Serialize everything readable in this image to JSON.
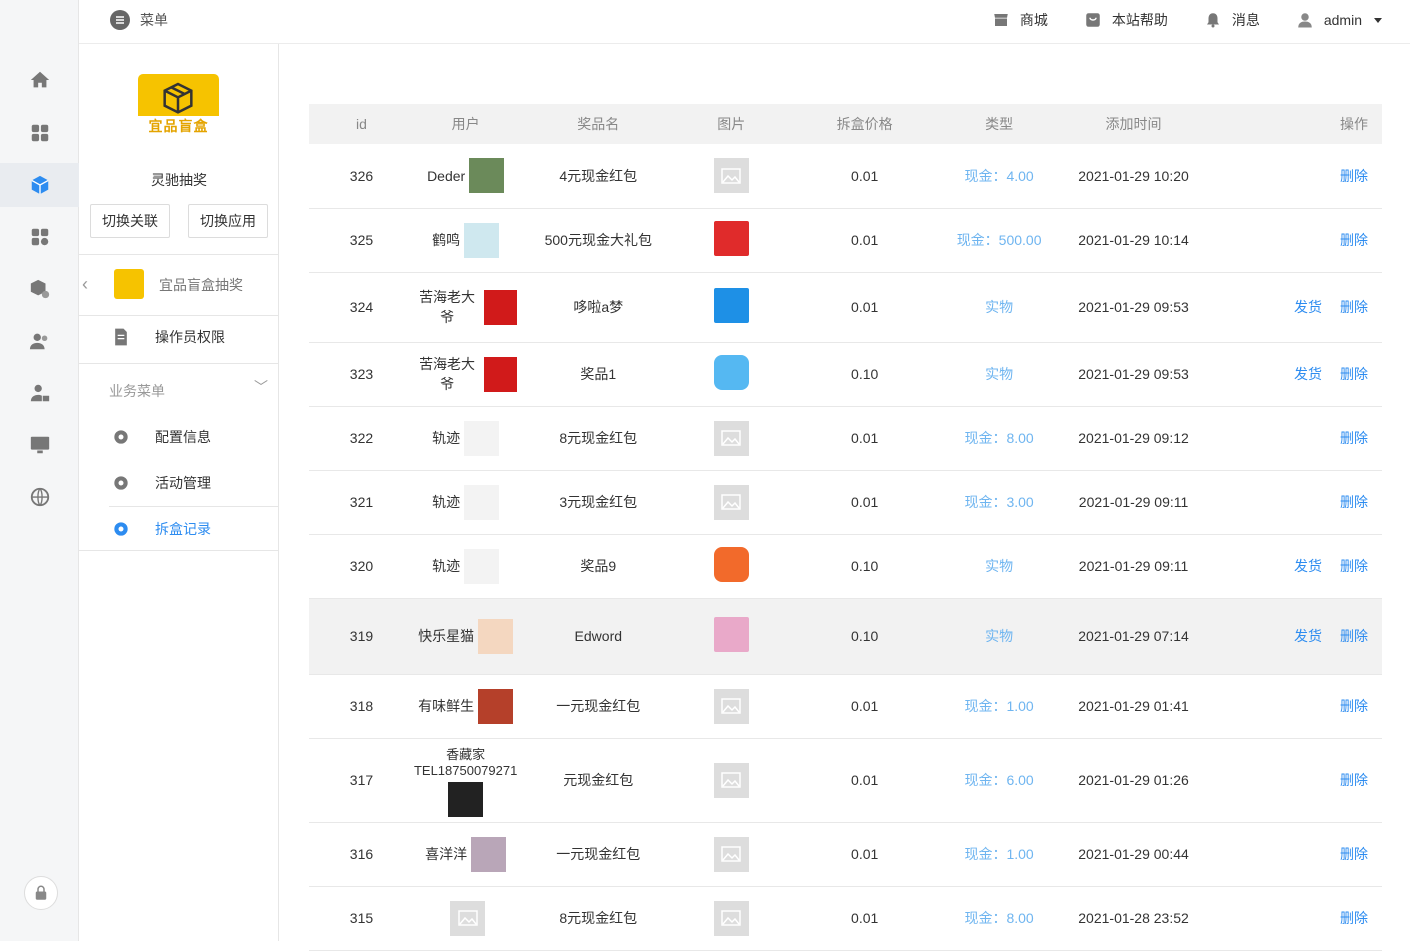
{
  "topbar": {
    "menu_label": "菜单",
    "links": [
      {
        "label": "商城",
        "icon": "store-icon"
      },
      {
        "label": "本站帮助",
        "icon": "help-icon"
      },
      {
        "label": "消息",
        "icon": "bell-icon"
      },
      {
        "label": "admin",
        "icon": "user-icon"
      }
    ]
  },
  "rail": {
    "items": [
      "home-icon",
      "grid-icon",
      "box-icon",
      "apps-icon",
      "box-gear-icon",
      "users-icon",
      "user-lock-icon",
      "monitor-icon",
      "globe-icon"
    ],
    "active_index": 2,
    "bottom": "lock-icon"
  },
  "subnav": {
    "brand_tag": "宜品盲盒",
    "app_name": "灵驰抽奖",
    "switch_link": "切换关联",
    "switch_app": "切换应用",
    "back_title": "宜品盲盒抽奖",
    "operator_permissions": "操作员权限",
    "group_title": "业务菜单",
    "items": [
      {
        "label": "配置信息",
        "icon": "gear-icon"
      },
      {
        "label": "活动管理",
        "icon": "gear-icon"
      },
      {
        "label": "拆盒记录",
        "icon": "gear-icon",
        "active": true
      }
    ]
  },
  "table": {
    "headers": [
      "id",
      "用户",
      "奖品名",
      "图片",
      "拆盒价格",
      "类型",
      "添加时间",
      "操作"
    ],
    "action_ship": "发货",
    "action_delete": "删除",
    "rows": [
      {
        "id": "326",
        "user": "Deder",
        "avatar": "photo-avatar",
        "prize": "4元现金红包",
        "image": "placeholder-image",
        "price": "0.01",
        "type": "现金：4.00",
        "time": "2021-01-29 10:20",
        "ship": false
      },
      {
        "id": "325",
        "user": "鹤鸣",
        "avatar": "cartoon-avatar",
        "prize": "500元现金大礼包",
        "image": "red-envelope-image",
        "price": "0.01",
        "type": "现金：500.00",
        "time": "2021-01-29 10:14",
        "ship": false
      },
      {
        "id": "324",
        "user": "苦海老大爷",
        "avatar": "fu-avatar",
        "prize": "哆啦a梦",
        "image": "doraemon-image",
        "price": "0.01",
        "type": "实物",
        "time": "2021-01-29 09:53",
        "ship": true
      },
      {
        "id": "323",
        "user": "苦海老大爷",
        "avatar": "fu-avatar",
        "prize": "奖品1",
        "image": "blue-app-image",
        "price": "0.10",
        "type": "实物",
        "time": "2021-01-29 09:53",
        "ship": true
      },
      {
        "id": "322",
        "user": "轨迹",
        "avatar": "text-avatar",
        "prize": "8元现金红包",
        "image": "placeholder-image",
        "price": "0.01",
        "type": "现金：8.00",
        "time": "2021-01-29 09:12",
        "ship": false
      },
      {
        "id": "321",
        "user": "轨迹",
        "avatar": "text-avatar",
        "prize": "3元现金红包",
        "image": "placeholder-image",
        "price": "0.01",
        "type": "现金：3.00",
        "time": "2021-01-29 09:11",
        "ship": false
      },
      {
        "id": "320",
        "user": "轨迹",
        "avatar": "text-avatar",
        "prize": "奖品9",
        "image": "orange-app-image",
        "price": "0.10",
        "type": "实物",
        "time": "2021-01-29 09:11",
        "ship": true
      },
      {
        "id": "319",
        "user": "快乐星猫",
        "avatar": "girl-avatar",
        "prize": "Edword",
        "image": "pink-scene-image",
        "price": "0.10",
        "type": "实物",
        "time": "2021-01-29 07:14",
        "ship": true,
        "highlight": true
      },
      {
        "id": "318",
        "user": "有味鲜生",
        "avatar": "food-avatar",
        "prize": "一元现金红包",
        "image": "placeholder-image",
        "price": "0.01",
        "type": "现金：1.00",
        "time": "2021-01-29 01:41",
        "ship": false
      },
      {
        "id": "317",
        "user": "香藏家TEL18750079271",
        "avatar": "dark-avatar",
        "prize": "元现金红包",
        "image": "placeholder-image",
        "price": "0.01",
        "type": "现金：6.00",
        "time": "2021-01-29 01:26",
        "ship": false
      },
      {
        "id": "316",
        "user": "喜洋洋",
        "avatar": "face-avatar",
        "prize": "一元现金红包",
        "image": "placeholder-image",
        "price": "0.01",
        "type": "现金：1.00",
        "time": "2021-01-29 00:44",
        "ship": false
      },
      {
        "id": "315",
        "user": "",
        "avatar": "placeholder-avatar",
        "prize": "8元现金红包",
        "image": "placeholder-image",
        "price": "0.01",
        "type": "现金：8.00",
        "time": "2021-01-28 23:52",
        "ship": false
      }
    ]
  }
}
